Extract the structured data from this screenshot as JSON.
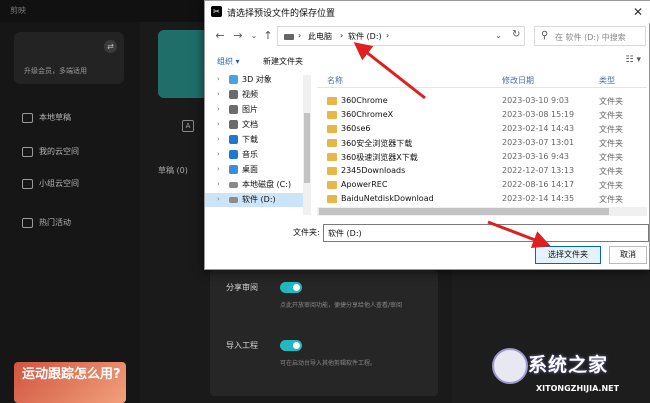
{
  "background_app": {
    "title": "剪映",
    "upgrade_text": "升级会员，多端适用",
    "nav": [
      {
        "label": "本地草稿"
      },
      {
        "label": "我的云空间"
      },
      {
        "label": "小组云空间"
      },
      {
        "label": "热门活动"
      }
    ],
    "draft_label": "草稿 (0)",
    "promo_text": "运动跟踪怎么用?",
    "settings": {
      "share_label": "分享审阅",
      "share_desc": "点此开放审阅功能，便捷分享给他人查看/审阅",
      "import_label": "导入工程",
      "import_desc": "可在启动台导入其他剪辑软件工程。"
    }
  },
  "dialog": {
    "title": "请选择预设文件的保存位置",
    "breadcrumb": [
      "此电脑",
      "软件 (D:)"
    ],
    "search_placeholder": "在 软件 (D:) 中搜索",
    "toolbar": {
      "organize": "组织 ▾",
      "new_folder": "新建文件夹"
    },
    "tree": [
      {
        "label": "3D 对象",
        "color": "#4aa3df"
      },
      {
        "label": "视频",
        "color": "#6b6b6b"
      },
      {
        "label": "图片",
        "color": "#6b6b6b"
      },
      {
        "label": "文档",
        "color": "#6b6b6b"
      },
      {
        "label": "下载",
        "color": "#1e78d2"
      },
      {
        "label": "音乐",
        "color": "#1e78d2"
      },
      {
        "label": "桌面",
        "color": "#3a8fd8"
      },
      {
        "label": "本地磁盘 (C:)",
        "color": "#8a8a8a"
      },
      {
        "label": "软件 (D:)",
        "color": "#8a8a8a"
      }
    ],
    "columns": {
      "name": "名称",
      "date": "修改日期",
      "type": "类型"
    },
    "files": [
      {
        "name": "360Chrome",
        "date": "2023-03-10 9:03",
        "type": "文件夹"
      },
      {
        "name": "360ChromeX",
        "date": "2023-03-08 15:19",
        "type": "文件夹"
      },
      {
        "name": "360se6",
        "date": "2023-02-14 14:43",
        "type": "文件夹"
      },
      {
        "name": "360安全浏览器下载",
        "date": "2023-03-07 13:01",
        "type": "文件夹"
      },
      {
        "name": "360极速浏览器X下载",
        "date": "2023-03-16 9:43",
        "type": "文件夹"
      },
      {
        "name": "2345Downloads",
        "date": "2022-12-07 13:13",
        "type": "文件夹"
      },
      {
        "name": "ApowerREC",
        "date": "2022-08-16 14:17",
        "type": "文件夹"
      },
      {
        "name": "BaiduNetdiskDownload",
        "date": "2023-02-14 14:35",
        "type": "文件夹"
      }
    ],
    "folder_label": "文件夹:",
    "folder_value": "软件 (D:)",
    "select_button": "选择文件夹",
    "cancel_button": "取消"
  },
  "watermark": {
    "cn": "系统之家",
    "en": "XITONGZHIJIA.NET"
  },
  "colors": {
    "accent_teal": "#23b8c0",
    "arrow_red": "#e02020",
    "link_blue": "#1a5fb4"
  }
}
